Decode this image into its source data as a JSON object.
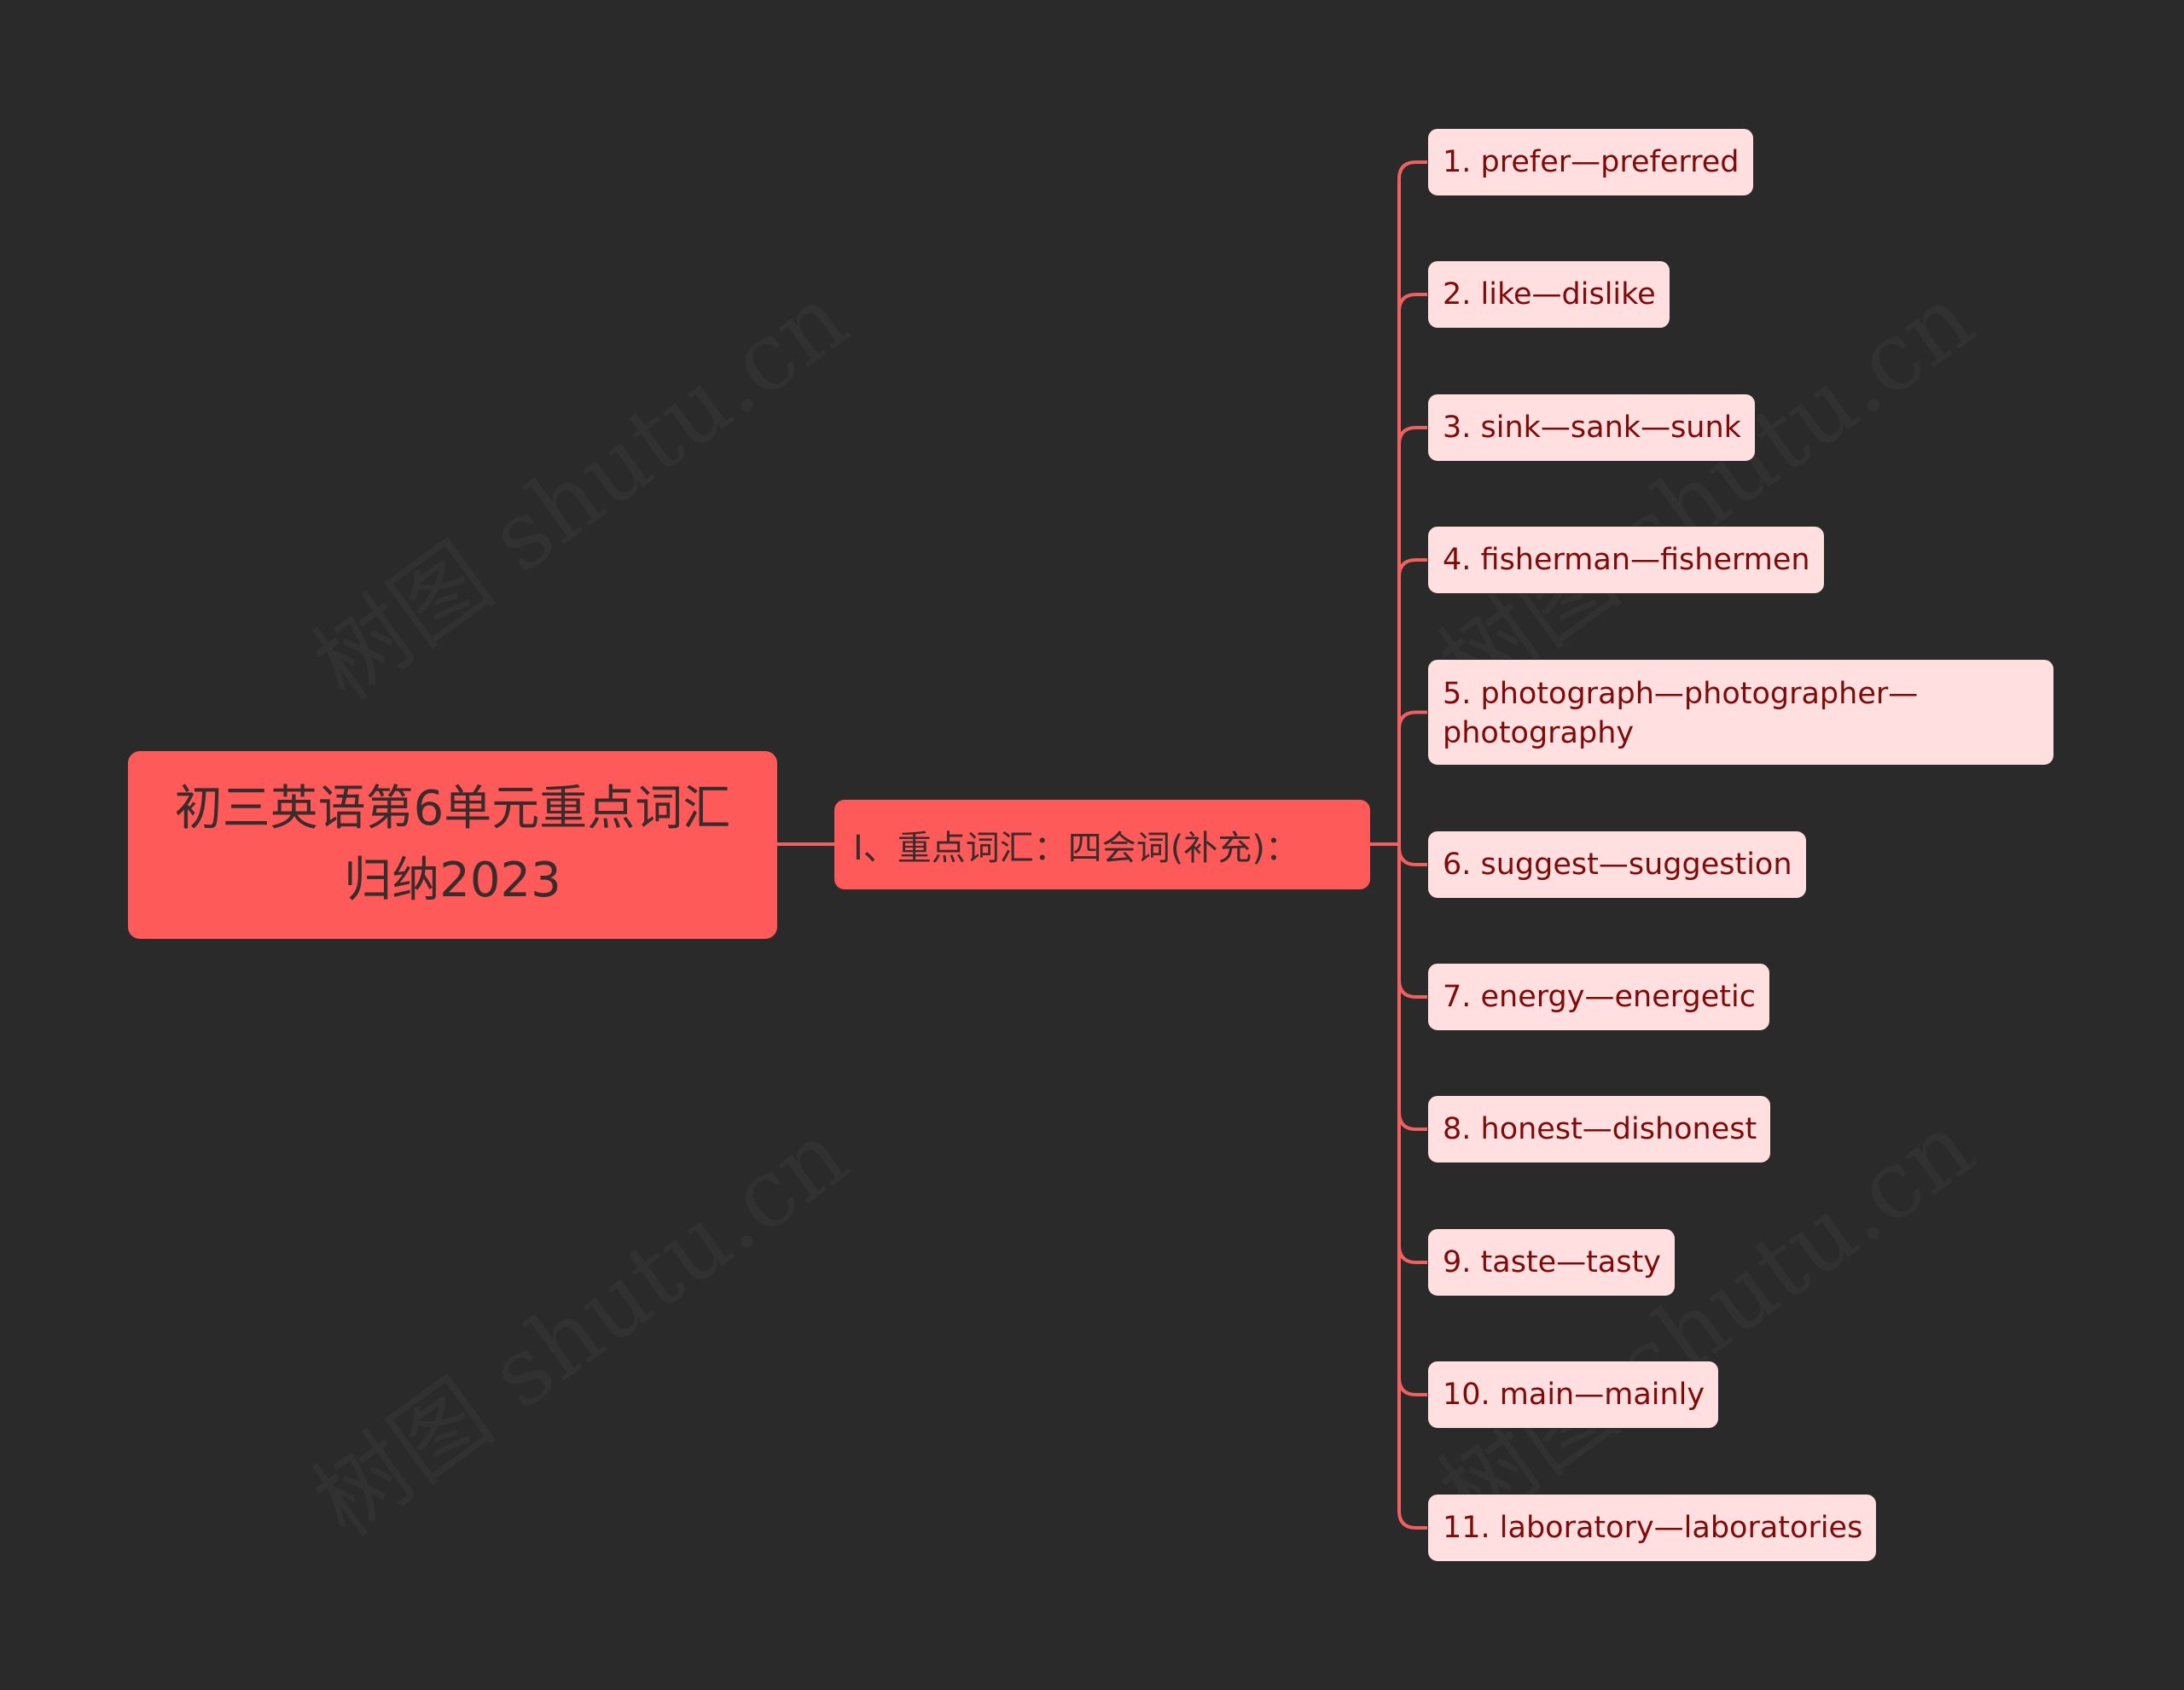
{
  "watermark": "树图 shutu.cn",
  "colors": {
    "background": "#2a2a2a",
    "root_fill": "#ff5a5a",
    "leaf_fill": "#ffdfdf",
    "leaf_text": "#7f0a0a",
    "connector": "#f06060"
  },
  "root": {
    "title": "初三英语第6单元重点词汇归纳2023"
  },
  "branch": {
    "label": "Ⅰ、重点词汇：四会词(补充)："
  },
  "leaves": [
    {
      "label": "1. prefer—preferred"
    },
    {
      "label": "2. like—dislike"
    },
    {
      "label": "3. sink—sank—sunk"
    },
    {
      "label": "4. fisherman—fishermen"
    },
    {
      "label": "5. photograph—photographer—photography"
    },
    {
      "label": "6. suggest—suggestion"
    },
    {
      "label": "7. energy—energetic"
    },
    {
      "label": "8. honest—dishonest"
    },
    {
      "label": "9. taste—tasty"
    },
    {
      "label": "10. main—mainly"
    },
    {
      "label": "11. laboratory—laboratories"
    }
  ]
}
